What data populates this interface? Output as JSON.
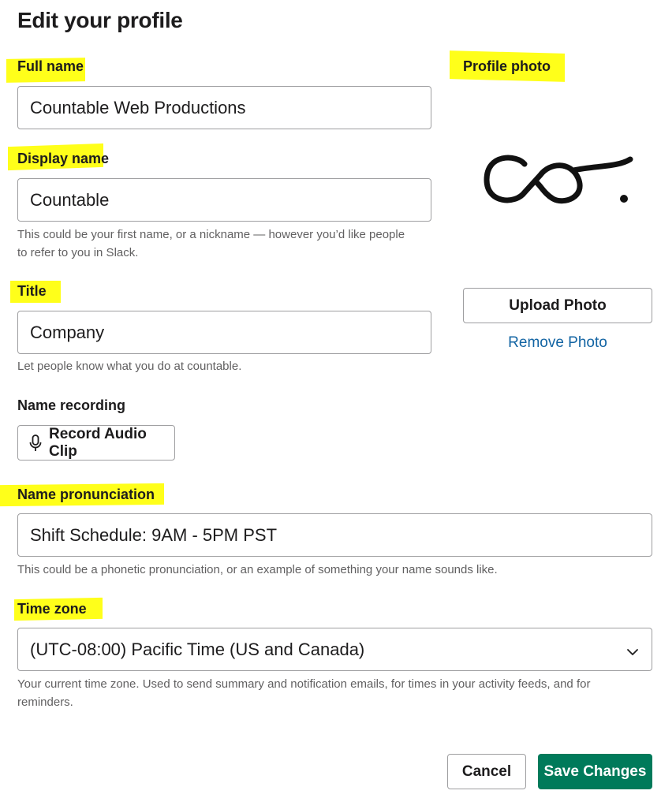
{
  "page": {
    "title": "Edit your profile"
  },
  "full_name": {
    "label": "Full name",
    "value": "Countable Web Productions"
  },
  "display_name": {
    "label": "Display name",
    "value": "Countable",
    "hint_line1": "This could be your first name, or a nickname — however you’d like people",
    "hint_line2": "to refer to you in Slack."
  },
  "title_field": {
    "label": "Title",
    "value": "Company",
    "hint": "Let people know what you do at countable."
  },
  "name_recording": {
    "label": "Name recording",
    "button_label": "Record Audio Clip",
    "icon": "microphone-icon"
  },
  "name_pronunciation": {
    "label": "Name pronunciation",
    "value": "Shift Schedule: 9AM - 5PM PST",
    "hint": "This could be a phonetic pronunciation, or an example of something your name sounds like."
  },
  "time_zone": {
    "label": "Time zone",
    "selected": "(UTC-08:00) Pacific Time (US and Canada)",
    "hint_line1": "Your current time zone. Used to send summary and notification emails, for times in your activity feeds, and for",
    "hint_line2": "reminders."
  },
  "profile_photo": {
    "label": "Profile photo",
    "upload_label": "Upload Photo",
    "remove_label": "Remove Photo"
  },
  "footer": {
    "cancel_label": "Cancel",
    "save_label": "Save Changes"
  },
  "colors": {
    "highlight": "#ffff1a",
    "primary": "#007a5a",
    "link": "#1264a3"
  }
}
